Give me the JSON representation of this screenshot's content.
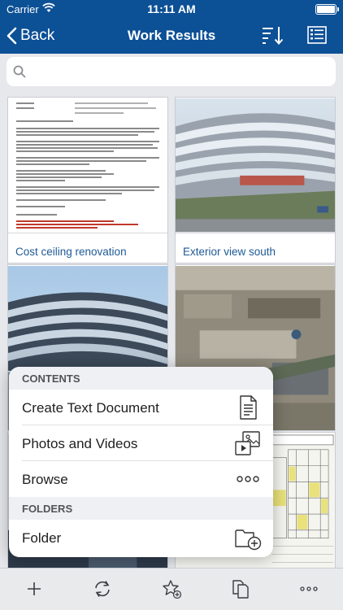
{
  "status": {
    "carrier": "Carrier",
    "time": "11:11 AM",
    "battery_level": 1.0
  },
  "nav": {
    "back_label": "Back",
    "title": "Work Results"
  },
  "search": {
    "placeholder": ""
  },
  "tiles": [
    {
      "caption": "Cost ceiling renovation",
      "kind": "document"
    },
    {
      "caption": "Exterior view  south",
      "kind": "photo"
    },
    {
      "caption": "",
      "kind": "photo"
    },
    {
      "caption": "",
      "kind": "photo"
    },
    {
      "caption": "",
      "kind": "photo"
    },
    {
      "caption": "",
      "kind": "blueprint"
    }
  ],
  "popup": {
    "contents_header": "CONTENTS",
    "items": [
      {
        "label": "Create Text Document",
        "icon": "text-document-icon"
      },
      {
        "label": "Photos and Videos",
        "icon": "photos-videos-icon"
      },
      {
        "label": "Browse",
        "icon": "more-icon"
      }
    ],
    "folders_header": "FOLDERS",
    "folder_item": {
      "label": "Folder",
      "icon": "add-folder-icon"
    }
  },
  "toolbar": [
    "add-icon",
    "refresh-icon",
    "favorite-add-icon",
    "duplicate-icon",
    "more-icon"
  ],
  "colors": {
    "nav": "#0c5096",
    "caption": "#1e5a96",
    "background": "#e6e8ec"
  }
}
